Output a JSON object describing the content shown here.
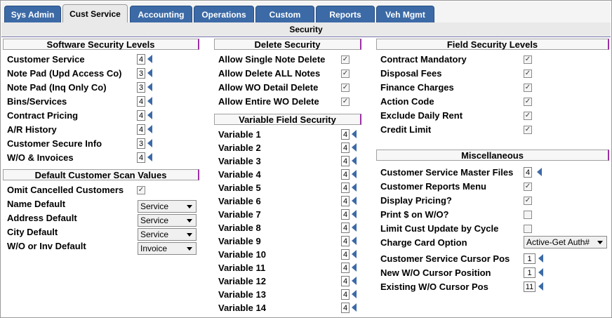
{
  "tabs": [
    "Sys Admin",
    "Cust Service",
    "Accounting",
    "Operations",
    "Custom",
    "Reports",
    "Veh Mgmt"
  ],
  "active_tab": "Cust Service",
  "section_title": "Security",
  "software_security": {
    "title": "Software Security Levels",
    "items": [
      {
        "label": "Customer Service",
        "value": "4"
      },
      {
        "label": "Note Pad (Upd Access Co)",
        "value": "3"
      },
      {
        "label": "Note Pad (Inq Only Co)",
        "value": "3"
      },
      {
        "label": "Bins/Services",
        "value": "4"
      },
      {
        "label": "Contract Pricing",
        "value": "4"
      },
      {
        "label": "A/R History",
        "value": "4"
      },
      {
        "label": "Customer Secure Info",
        "value": "3"
      },
      {
        "label": "W/O & Invoices",
        "value": "4"
      }
    ]
  },
  "default_scan": {
    "title": "Default Customer Scan Values",
    "omit_label": "Omit Cancelled Customers",
    "omit_checked": true,
    "defaults": [
      {
        "label": "Name Default",
        "value": "Service"
      },
      {
        "label": "Address Default",
        "value": "Service"
      },
      {
        "label": "City Default",
        "value": "Service"
      },
      {
        "label": "W/O or Inv Default",
        "value": "Invoice"
      }
    ]
  },
  "delete_security": {
    "title": "Delete Security",
    "items": [
      {
        "label": "Allow Single Note Delete",
        "checked": true
      },
      {
        "label": "Allow Delete ALL Notes",
        "checked": true
      },
      {
        "label": "Allow WO Detail Delete",
        "checked": true
      },
      {
        "label": "Allow Entire WO Delete",
        "checked": true
      }
    ]
  },
  "variable_security": {
    "title": "Variable Field Security",
    "items": [
      {
        "label": "Variable 1",
        "value": "4"
      },
      {
        "label": "Variable 2",
        "value": "4"
      },
      {
        "label": "Variable 3",
        "value": "4"
      },
      {
        "label": "Variable 4",
        "value": "4"
      },
      {
        "label": "Variable 5",
        "value": "4"
      },
      {
        "label": "Variable 6",
        "value": "4"
      },
      {
        "label": "Variable 7",
        "value": "4"
      },
      {
        "label": "Variable 8",
        "value": "4"
      },
      {
        "label": "Variable 9",
        "value": "4"
      },
      {
        "label": "Variable 10",
        "value": "4"
      },
      {
        "label": "Variable 11",
        "value": "4"
      },
      {
        "label": "Variable 12",
        "value": "4"
      },
      {
        "label": "Variable 13",
        "value": "4"
      },
      {
        "label": "Variable 14",
        "value": "4"
      }
    ]
  },
  "field_security": {
    "title": "Field Security Levels",
    "items": [
      {
        "label": "Contract Mandatory",
        "checked": true
      },
      {
        "label": "Disposal Fees",
        "checked": true
      },
      {
        "label": "Finance Charges",
        "checked": true
      },
      {
        "label": "Action Code",
        "checked": true
      },
      {
        "label": "Exclude Daily Rent",
        "checked": true
      },
      {
        "label": "Credit Limit",
        "checked": true
      }
    ]
  },
  "misc": {
    "title": "Miscellaneous",
    "master_files_label": "Customer Service Master Files",
    "master_files_value": "4",
    "reports_menu_label": "Customer Reports Menu",
    "reports_menu_checked": true,
    "display_pricing_label": "Display Pricing?",
    "display_pricing_checked": true,
    "print_label": "Print $ on W/O?",
    "print_checked": false,
    "limit_label": "Limit Cust Update by Cycle",
    "limit_checked": false,
    "charge_card_label": "Charge Card Option",
    "charge_card_value": "Active-Get Auth#",
    "cursor_items": [
      {
        "label": "Customer Service Cursor Pos",
        "value": "1"
      },
      {
        "label": "New W/O Cursor Position",
        "value": "1"
      },
      {
        "label": "Existing W/O Cursor Pos",
        "value": "11"
      }
    ]
  }
}
